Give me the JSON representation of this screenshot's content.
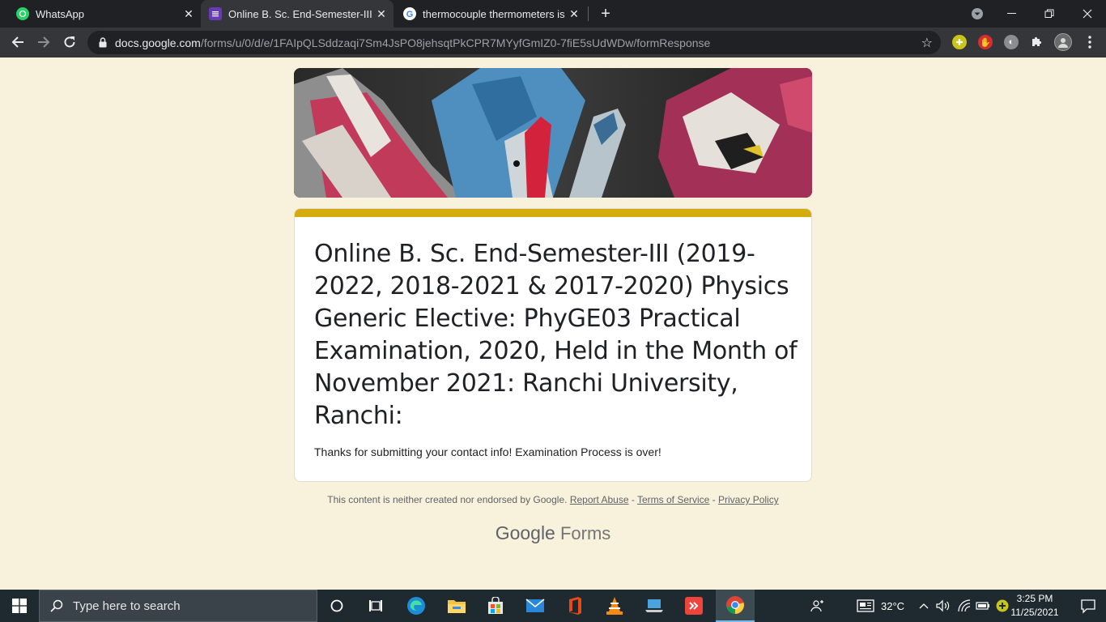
{
  "browser": {
    "tabs": [
      {
        "title": "WhatsApp",
        "active": false
      },
      {
        "title": "Online B. Sc. End-Semester-III (20",
        "active": true
      },
      {
        "title": "thermocouple thermometers is n",
        "active": false
      }
    ],
    "new_tab": "+",
    "url_host": "docs.google.com",
    "url_path": "/forms/u/0/d/e/1FAIpQLSddzaqi7Sm4JsPO8jehsqtPkCPR7MYyfGmIZ0-7fiE5sUdWDw/formResponse"
  },
  "form": {
    "title": "Online B. Sc. End-Semester-III (2019-2022, 2018-2021 & 2017-2020) Physics Generic Elective: PhyGE03 Practical Examination, 2020, Held in the Month of November 2021: Ranchi University, Ranchi:",
    "confirmation": "Thanks for submitting your contact info! Examination Process is over!",
    "accent_color": "#d4ac0d",
    "background_color": "#f8f1dc"
  },
  "footer": {
    "disclaimer": "This content is neither created nor endorsed by Google.",
    "report_abuse": "Report Abuse",
    "sep": " - ",
    "terms": "Terms of Service",
    "privacy": "Privacy Policy",
    "brand_google": "Google",
    "brand_forms": "Forms"
  },
  "taskbar": {
    "search_placeholder": "Type here to search",
    "temperature": "32°C",
    "time": "3:25 PM",
    "date": "11/25/2021"
  }
}
